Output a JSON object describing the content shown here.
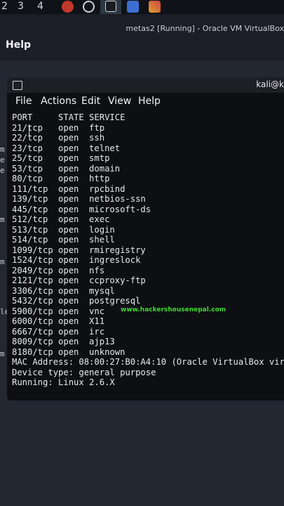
{
  "topbar": {
    "workspaces": [
      "2",
      "3",
      "4"
    ],
    "colors": {
      "bg": "#0f1318",
      "active": "#2d3645"
    }
  },
  "vbox": {
    "title": "metas2 [Running] - Oracle VM VirtualBox",
    "menu_help": "Help"
  },
  "left_cut": [
    "m",
    "e",
    "e",
    "m",
    "m",
    "le",
    "m"
  ],
  "terminal": {
    "title": "kali@k",
    "menu": [
      "File",
      "Actions",
      "Edit",
      "View",
      "Help"
    ],
    "lines": [
      "PORT     STATE SERVICE",
      "21/tcp   open  ftp",
      "22/tcp   open  ssh",
      "23/tcp   open  telnet",
      "25/tcp   open  smtp",
      "53/tcp   open  domain",
      "80/tcp   open  http",
      "111/tcp  open  rpcbind",
      "139/tcp  open  netbios-ssn",
      "445/tcp  open  microsoft-ds",
      "512/tcp  open  exec",
      "513/tcp  open  login",
      "514/tcp  open  shell",
      "1099/tcp open  rmiregistry",
      "1524/tcp open  ingreslock",
      "2049/tcp open  nfs",
      "2121/tcp open  ccproxy-ftp",
      "3306/tcp open  mysql",
      "5432/tcp open  postgresql",
      "5900/tcp open  vnc",
      "6000/tcp open  X11",
      "6667/tcp open  irc",
      "8009/tcp open  ajp13",
      "8180/tcp open  unknown",
      "MAC Address: 08:00:27:B0:A4:10 (Oracle VirtualBox vir",
      "Device type: general purpose",
      "Running: Linux 2.6.X"
    ],
    "watermark": "www.hackershousenepal.com"
  }
}
